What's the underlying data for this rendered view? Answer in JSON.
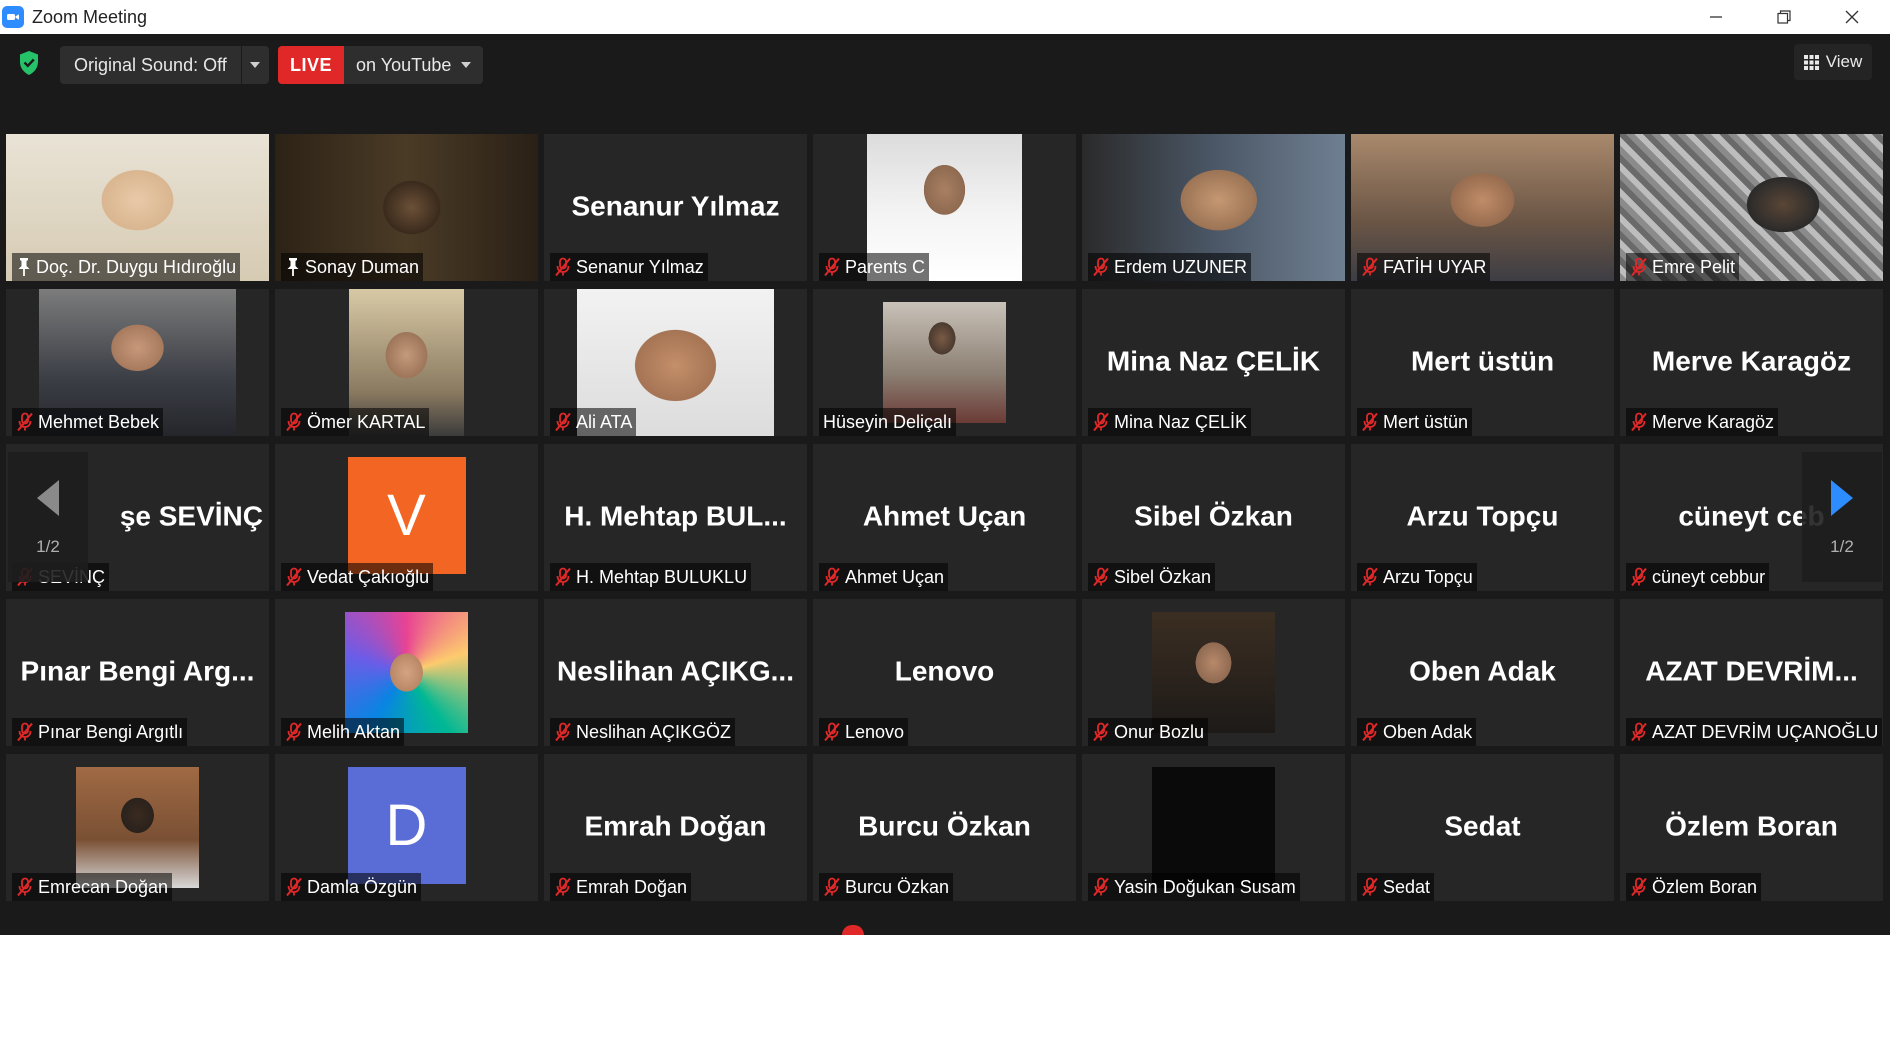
{
  "window": {
    "title": "Zoom Meeting"
  },
  "toolbar": {
    "original_sound_label": "Original Sound: Off",
    "live_label": "LIVE",
    "live_target": "on YouTube",
    "view_label": "View"
  },
  "pager": {
    "left_label": "1/2",
    "right_label": "1/2"
  },
  "colors": {
    "accent": "#2d8cff",
    "live": "#e02828",
    "active_speaker": "#b8e63a",
    "muted": "#e02828"
  },
  "participants": [
    {
      "name": "Doç. Dr. Duygu Hıdıroğlu",
      "big": "",
      "video": true,
      "pinned": true,
      "muted": false,
      "active": true
    },
    {
      "name": "Sonay Duman",
      "big": "",
      "video": true,
      "pinned": true,
      "muted": false
    },
    {
      "name": "Senanur Yılmaz",
      "big": "Senanur Yılmaz",
      "video": false,
      "muted": true
    },
    {
      "name": "Parents C",
      "big": "",
      "video": true,
      "muted": true
    },
    {
      "name": "Erdem UZUNER",
      "big": "",
      "video": true,
      "muted": true
    },
    {
      "name": "FATİH UYAR",
      "big": "",
      "video": true,
      "muted": true
    },
    {
      "name": "Emre Pelit",
      "big": "",
      "video": true,
      "muted": true
    },
    {
      "name": "Mehmet Bebek",
      "big": "",
      "video": true,
      "muted": true
    },
    {
      "name": "Ömer KARTAL",
      "big": "",
      "video": true,
      "muted": true
    },
    {
      "name": "Ali ATA",
      "big": "",
      "video": true,
      "muted": true
    },
    {
      "name": "Hüseyin Deliçalı",
      "big": "",
      "video": true,
      "muted": false
    },
    {
      "name": "Mina Naz ÇELİK",
      "big": "Mina Naz ÇELİK",
      "video": false,
      "muted": true
    },
    {
      "name": "Mert üstün",
      "big": "Mert üstün",
      "video": false,
      "muted": true
    },
    {
      "name": "Merve Karagöz",
      "big": "Merve Karagöz",
      "video": false,
      "muted": true
    },
    {
      "name": "SEVİNÇ",
      "big": "şe SEVİNÇ",
      "video": false,
      "muted": true
    },
    {
      "name": "Vedat Çakıoğlu",
      "big": "",
      "video": false,
      "avatar": "V",
      "avatar_color": "#f26522",
      "muted": true
    },
    {
      "name": "H. Mehtap BULUKLU",
      "big": "H. Mehtap BUL...",
      "video": false,
      "muted": true
    },
    {
      "name": "Ahmet Uçan",
      "big": "Ahmet Uçan",
      "video": false,
      "muted": true
    },
    {
      "name": "Sibel Özkan",
      "big": "Sibel Özkan",
      "video": false,
      "muted": true
    },
    {
      "name": "Arzu Topçu",
      "big": "Arzu Topçu",
      "video": false,
      "muted": true
    },
    {
      "name": "cüneyt cebbur",
      "big": "cüneyt ceb",
      "video": false,
      "muted": true
    },
    {
      "name": "Pınar Bengi Argıtlı",
      "big": "Pınar Bengi Arg...",
      "video": false,
      "muted": true
    },
    {
      "name": "Melih Aktan",
      "big": "",
      "video": true,
      "muted": true
    },
    {
      "name": "Neslihan AÇIKGÖZ",
      "big": "Neslihan AÇIKG...",
      "video": false,
      "muted": true
    },
    {
      "name": "Lenovo",
      "big": "Lenovo",
      "video": false,
      "muted": true
    },
    {
      "name": "Onur Bozlu",
      "big": "",
      "video": true,
      "muted": true
    },
    {
      "name": "Oben Adak",
      "big": "Oben Adak",
      "video": false,
      "muted": true
    },
    {
      "name": "AZAT DEVRİM UÇANOĞLU",
      "big": "AZAT DEVRİM...",
      "video": false,
      "muted": true
    },
    {
      "name": "Emrecan Doğan",
      "big": "",
      "video": true,
      "muted": true
    },
    {
      "name": "Damla Özgün",
      "big": "",
      "video": false,
      "avatar": "D",
      "avatar_color": "#5a6cd6",
      "muted": true
    },
    {
      "name": "Emrah Doğan",
      "big": "Emrah Doğan",
      "video": false,
      "muted": true
    },
    {
      "name": "Burcu Özkan",
      "big": "Burcu Özkan",
      "video": false,
      "muted": true
    },
    {
      "name": "Yasin Doğukan Susam",
      "big": "",
      "video": true,
      "muted": true
    },
    {
      "name": "Sedat",
      "big": "Sedat",
      "video": false,
      "muted": true
    },
    {
      "name": "Özlem Boran",
      "big": "Özlem Boran",
      "video": false,
      "muted": true
    }
  ]
}
